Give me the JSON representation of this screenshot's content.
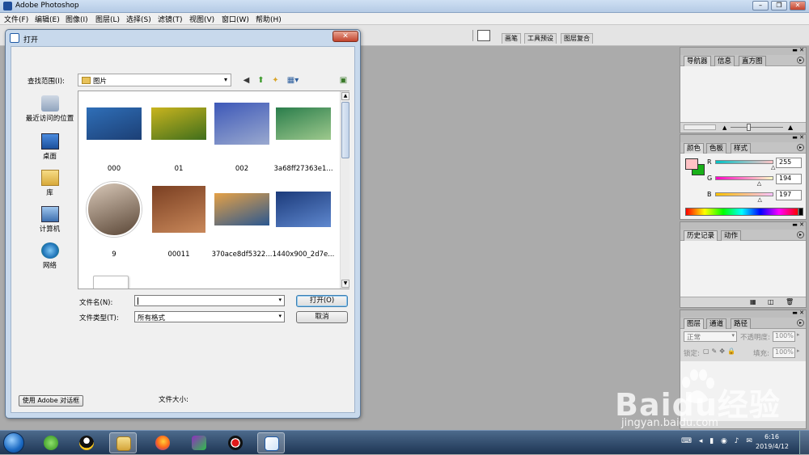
{
  "app": {
    "title": "Adobe Photoshop"
  },
  "menu": [
    "文件(F)",
    "编辑(E)",
    "图像(I)",
    "图层(L)",
    "选择(S)",
    "滤镜(T)",
    "视图(V)",
    "窗口(W)",
    "帮助(H)"
  ],
  "palette_well_tabs": [
    "画笔",
    "工具预设",
    "图层复合"
  ],
  "palettes": {
    "navigator": {
      "tabs": [
        "导航器",
        "信息",
        "直方图"
      ]
    },
    "color": {
      "tabs": [
        "颜色",
        "色板",
        "样式"
      ],
      "channels": [
        {
          "label": "R",
          "value": "255",
          "level": 1.0
        },
        {
          "label": "G",
          "value": "194",
          "level": 0.76
        },
        {
          "label": "B",
          "value": "197",
          "level": 0.77
        }
      ],
      "foreground": "#ffc2c5",
      "background": "#19b019"
    },
    "history": {
      "tabs": [
        "历史记录",
        "动作"
      ]
    },
    "layers": {
      "tabs": [
        "图层",
        "通道",
        "路径"
      ],
      "blend_mode": "正常",
      "opacity_label": "不透明度:",
      "opacity_value": "100%",
      "lock_label": "锁定:",
      "fill_label": "填充:",
      "fill_value": "100%"
    }
  },
  "dialog": {
    "title": "打开",
    "look_in_label": "查找范围(I):",
    "look_in_value": "图片",
    "places": [
      "最近访问的位置",
      "桌面",
      "库",
      "计算机",
      "网络"
    ],
    "files": [
      {
        "name": "000",
        "colors": [
          "#2f6fb8",
          "#1c3f75"
        ]
      },
      {
        "name": "01",
        "colors": [
          "#c9b41e",
          "#3f6e1c"
        ]
      },
      {
        "name": "002",
        "colors": [
          "#3d58b8",
          "#9aa9cf"
        ]
      },
      {
        "name": "3a68ff27363e1...",
        "colors": [
          "#2a7d4b",
          "#9ec98d"
        ]
      },
      {
        "name": "9",
        "colors": [
          "#d8c8b8",
          "#5a4636"
        ]
      },
      {
        "name": "00011",
        "colors": [
          "#7a3f22",
          "#c9885a"
        ]
      },
      {
        "name": "370ace8df5322...",
        "colors": [
          "#e5a146",
          "#2a5790"
        ]
      },
      {
        "name": "1440x900_2d7e...",
        "colors": [
          "#1b3a7a",
          "#5f88cf"
        ]
      }
    ],
    "filename_label": "文件名(N):",
    "filename_value": "",
    "filetype_label": "文件类型(T):",
    "filetype_value": "所有格式",
    "open_button": "打开(O)",
    "cancel_button": "取消",
    "use_adobe_dialog": "使用 Adobe 对话框",
    "filesize_label": "文件大小:"
  },
  "taskbar": {
    "time": "6:16",
    "date": "2019/4/12"
  },
  "watermark": {
    "logo": "Baidu经验",
    "url": "jingyan.baidu.com"
  }
}
